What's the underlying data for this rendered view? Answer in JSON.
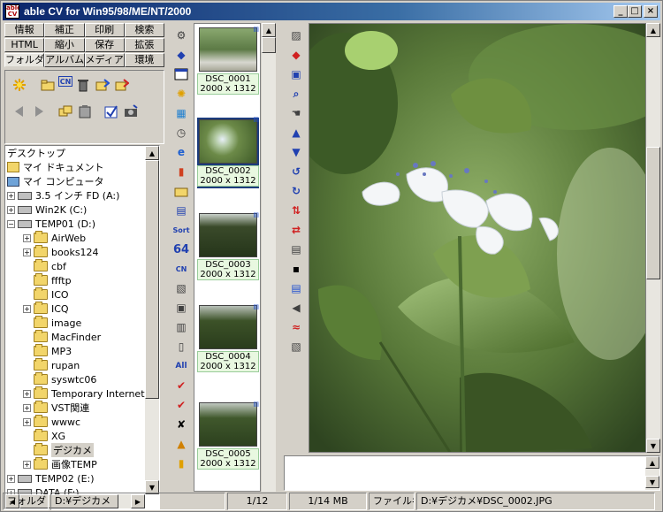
{
  "window": {
    "logo_text": "able CV",
    "title": "able CV for Win95/98/ME/NT/2000",
    "minimize": "_",
    "maximize": "□",
    "close": "×"
  },
  "tabs": {
    "row1": [
      "情報",
      "補正",
      "印刷",
      "検索"
    ],
    "row2": [
      "HTML",
      "縮小",
      "保存",
      "拡張"
    ],
    "row3": [
      "フォルダ",
      "アルバム",
      "メディア",
      "環境"
    ]
  },
  "tree": {
    "items": [
      {
        "label": "デスクトップ",
        "icon": "desktop-icon"
      },
      {
        "label": "マイ ドキュメント",
        "icon": "my-documents-icon"
      },
      {
        "label": "マイ コンピュータ",
        "icon": "my-computer-icon"
      },
      {
        "label": "3.5 インチ FD (A:)",
        "icon": "floppy-icon"
      },
      {
        "label": "Win2K (C:)",
        "icon": "drive-icon"
      },
      {
        "label": "TEMP01 (D:)",
        "icon": "drive-icon"
      },
      {
        "label": "AirWeb",
        "icon": "folder-icon"
      },
      {
        "label": "books124",
        "icon": "folder-icon"
      },
      {
        "label": "cbf",
        "icon": "folder-icon"
      },
      {
        "label": "ffftp",
        "icon": "folder-icon"
      },
      {
        "label": "ICO",
        "icon": "folder-icon"
      },
      {
        "label": "ICQ",
        "icon": "folder-icon"
      },
      {
        "label": "image",
        "icon": "folder-icon"
      },
      {
        "label": "MacFinder",
        "icon": "folder-icon"
      },
      {
        "label": "MP3",
        "icon": "folder-icon"
      },
      {
        "label": "rupan",
        "icon": "folder-icon"
      },
      {
        "label": "syswtc06",
        "icon": "folder-icon"
      },
      {
        "label": "Temporary Internet",
        "icon": "folder-icon"
      },
      {
        "label": "VST関連",
        "icon": "folder-icon"
      },
      {
        "label": "wwwc",
        "icon": "folder-icon"
      },
      {
        "label": "XG",
        "icon": "folder-icon"
      },
      {
        "label": "デジカメ",
        "icon": "folder-open-icon"
      },
      {
        "label": "画像TEMP",
        "icon": "folder-icon"
      },
      {
        "label": "TEMP02 (E:)",
        "icon": "drive-icon"
      },
      {
        "label": "DATA (F:)",
        "icon": "drive-icon"
      }
    ]
  },
  "thumbnails": [
    {
      "name": "DSC_0001",
      "size": "2000 x 1312"
    },
    {
      "name": "DSC_0002",
      "size": "2000 x 1312"
    },
    {
      "name": "DSC_0003",
      "size": "2000 x 1312"
    },
    {
      "name": "DSC_0004",
      "size": "2000 x 1312"
    },
    {
      "name": "DSC_0005",
      "size": "2000 x 1312"
    }
  ],
  "toolbar_glyphs": {
    "count_64": "64",
    "all": "All",
    "sort": "Sort",
    "cn": "CN"
  },
  "status": {
    "folder_label": "フォルダ",
    "folder_path": "D:¥デジカメ",
    "position": "1/12",
    "memory": "1/14 MB",
    "file_label": "ファイル名",
    "file_path": "D:¥デジカメ¥DSC_0002.JPG"
  }
}
